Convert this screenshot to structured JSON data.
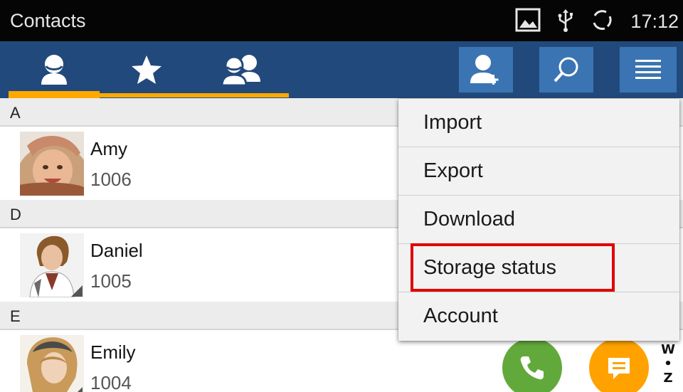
{
  "status_bar": {
    "app_title": "Contacts",
    "time": "17:12",
    "icons": [
      "image-notification-icon",
      "usb-icon",
      "sync-icon"
    ]
  },
  "action_bar": {
    "tabs": [
      {
        "name": "all-contacts",
        "icon": "person-icon",
        "selected": true
      },
      {
        "name": "favorites",
        "icon": "star-icon",
        "selected": false
      },
      {
        "name": "groups",
        "icon": "group-icon",
        "selected": false
      }
    ],
    "buttons": [
      "add-contact-icon",
      "search-icon",
      "menu-icon"
    ]
  },
  "contacts": [
    {
      "section": "A",
      "name": "Amy",
      "number": "1006"
    },
    {
      "section": "D",
      "name": "Daniel",
      "number": "1005"
    },
    {
      "section": "E",
      "name": "Emily",
      "number": "1004"
    }
  ],
  "index": {
    "top": "W",
    "bottom": "Z"
  },
  "menu": {
    "items": [
      "Import",
      "Export",
      "Download",
      "Storage status",
      "Account"
    ],
    "highlighted": "Storage status"
  },
  "colors": {
    "status_bar": "#050505",
    "action_bar": "#22497b",
    "button": "#3b74b2",
    "tab_indicator": "#ffa800",
    "call": "#62a93b",
    "message": "#ffa200",
    "highlight": "#e00000"
  }
}
